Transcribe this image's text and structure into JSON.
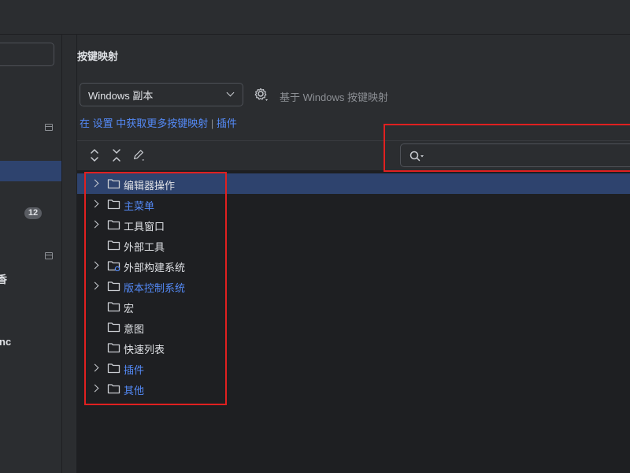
{
  "page_title": "按键映射",
  "keymap": {
    "selected": "Windows 副本",
    "based_on": "基于 Windows 按键映射"
  },
  "links": {
    "prefix": "在 设置 中获取更多按键映射",
    "separator": "|",
    "plugins": "插件"
  },
  "search": {
    "value": "",
    "placeholder": ""
  },
  "sidebar": {
    "badge": "12",
    "text_1": "香",
    "text_2": "nc"
  },
  "tree": [
    {
      "label": "编辑器操作",
      "expandable": true,
      "modified": false,
      "selected": true
    },
    {
      "label": "主菜单",
      "expandable": true,
      "modified": true,
      "selected": false
    },
    {
      "label": "工具窗口",
      "expandable": true,
      "modified": false,
      "selected": false
    },
    {
      "label": "外部工具",
      "expandable": false,
      "modified": false,
      "selected": false
    },
    {
      "label": "外部构建系统",
      "expandable": true,
      "modified": false,
      "selected": false
    },
    {
      "label": "版本控制系统",
      "expandable": true,
      "modified": true,
      "selected": false
    },
    {
      "label": "宏",
      "expandable": false,
      "modified": false,
      "selected": false
    },
    {
      "label": "意图",
      "expandable": false,
      "modified": false,
      "selected": false
    },
    {
      "label": "快速列表",
      "expandable": false,
      "modified": false,
      "selected": false
    },
    {
      "label": "插件",
      "expandable": true,
      "modified": true,
      "selected": false
    },
    {
      "label": "其他",
      "expandable": true,
      "modified": true,
      "selected": false
    }
  ],
  "colors": {
    "background": "#2b2d30",
    "tree_background": "#1e1f22",
    "selection": "#2e436e",
    "link": "#548af7",
    "annotation_red": "#e02020"
  }
}
